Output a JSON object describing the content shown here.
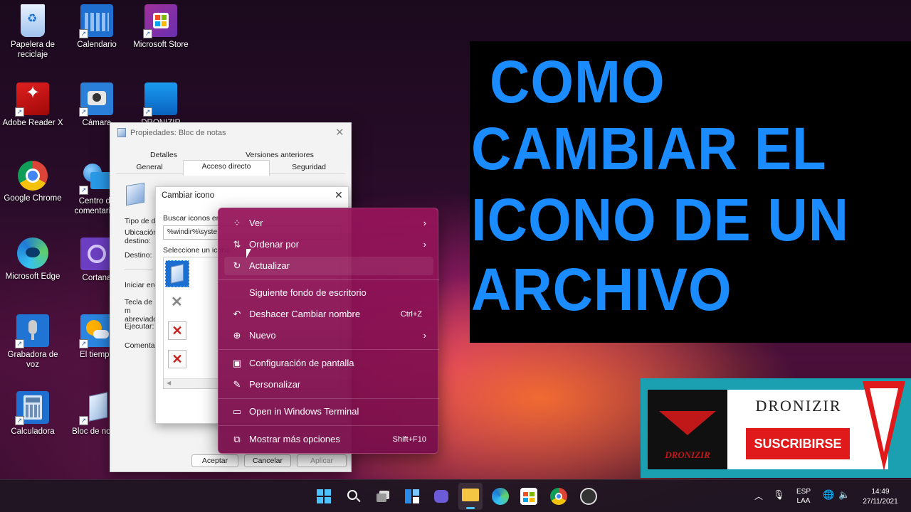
{
  "desktop": {
    "icons": [
      {
        "label": "Papelera de reciclaje"
      },
      {
        "label": "Calendario"
      },
      {
        "label": "Microsoft Store"
      },
      {
        "label": "Adobe Reader X"
      },
      {
        "label": "Cámara"
      },
      {
        "label": "DRONIZIR"
      },
      {
        "label": "Google Chrome"
      },
      {
        "label": "Centro de comentarios"
      },
      {
        "label": "Microsoft Edge"
      },
      {
        "label": "Cortana"
      },
      {
        "label": "Grabadora de voz"
      },
      {
        "label": "El tiempo"
      },
      {
        "label": "Calculadora"
      },
      {
        "label": "Bloc de notas"
      }
    ]
  },
  "title_overlay": {
    "lines": [
      "COMO",
      "CAMBIAR EL",
      "ICONO DE UN",
      "ARCHIVO"
    ],
    "color": "#1a8cff"
  },
  "properties_dialog": {
    "title": "Propiedades: Bloc de notas",
    "tabs_row1": [
      "Detalles",
      "Versiones anteriores"
    ],
    "tabs_row2": [
      "General",
      "Acceso directo",
      "Seguridad"
    ],
    "fields": [
      "Tipo de de",
      "Ubicación destino:",
      "Destino:",
      "Iniciar en:",
      "Tecla de m abreviado",
      "Ejecutar:",
      "Comentari"
    ],
    "buttons": {
      "accept": "Aceptar",
      "cancel": "Cancelar",
      "apply": "Aplicar"
    }
  },
  "change_icon_dialog": {
    "title": "Cambiar icono",
    "search_label": "Buscar iconos en",
    "search_value": "%windir%\\syste",
    "select_label": "Seleccione un icono"
  },
  "context_menu": {
    "items": [
      {
        "icon": "grid-icon",
        "glyph": "⁘",
        "label": "Ver",
        "submenu": true
      },
      {
        "icon": "sort-icon",
        "glyph": "⇅",
        "label": "Ordenar por",
        "submenu": true
      },
      {
        "icon": "refresh-icon",
        "glyph": "↻",
        "label": "Actualizar",
        "hover": true
      },
      {
        "icon": "",
        "glyph": "",
        "label": "Siguiente fondo de escritorio"
      },
      {
        "icon": "undo-icon",
        "glyph": "↶",
        "label": "Deshacer Cambiar nombre",
        "shortcut": "Ctrl+Z"
      },
      {
        "icon": "new-icon",
        "glyph": "⊕",
        "label": "Nuevo",
        "submenu": true
      },
      {
        "icon": "display-settings-icon",
        "glyph": "▣",
        "label": "Configuración de pantalla"
      },
      {
        "icon": "brush-icon",
        "glyph": "✎",
        "label": "Personalizar"
      },
      {
        "icon": "terminal-icon",
        "glyph": "▭",
        "label": "Open in Windows Terminal"
      },
      {
        "icon": "more-options-icon",
        "glyph": "⧉",
        "label": "Mostrar más opciones",
        "shortcut": "Shift+F10"
      }
    ]
  },
  "banner": {
    "channel": "DRONIZIR",
    "logo_text": "DRONIZIR",
    "subscribe": "SUSCRIBIRSE"
  },
  "taskbar": {
    "tray": {
      "lang_top": "ESP",
      "lang_bottom": "LAA",
      "time": "14:49",
      "date": "27/11/2021"
    }
  }
}
